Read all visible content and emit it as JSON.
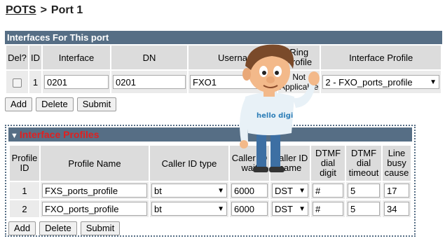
{
  "breadcrumb": {
    "root": "POTS",
    "sep": ">",
    "current": "Port 1"
  },
  "interfaces": {
    "header": "Interfaces For This port",
    "columns": [
      "Del?",
      "ID",
      "Interface",
      "DN",
      "Userna",
      "Ring Profile",
      "Interface Profile"
    ],
    "row": {
      "id": "1",
      "interface": "0201",
      "dn": "0201",
      "username": "FXO1",
      "ring_profile_top": "Not",
      "ring_profile_bottom": "Applicable",
      "interface_profile": "2 - FXO_ports_profile"
    },
    "buttons": {
      "add": "Add",
      "delete": "Delete",
      "submit": "Submit"
    }
  },
  "profiles": {
    "header": "Interface Profiles",
    "columns": {
      "profile_id": "Profile ID",
      "profile_name": "Profile Name",
      "caller_id_type": "Caller ID type",
      "caller_id_wait": "Caller ID wait",
      "caller_id_name": "Caller ID name",
      "dtmf_dial_digit": "DTMF dial digit",
      "dtmf_dial_timeout": "DTMF dial timeout",
      "line_busy_cause": "Line busy cause"
    },
    "rows": [
      {
        "id": "1",
        "name": "FXS_ports_profile",
        "caller_type": "bt",
        "wait": "6000",
        "dst": "DST",
        "digit": "#",
        "timeout": "5",
        "busy": "17"
      },
      {
        "id": "2",
        "name": "FXO_ports_profile",
        "caller_type": "bt",
        "wait": "6000",
        "dst": "DST",
        "digit": "#",
        "timeout": "5",
        "busy": "34"
      }
    ],
    "buttons": {
      "add": "Add",
      "delete": "Delete",
      "submit": "Submit"
    }
  },
  "mascot": {
    "shirt_text": "hello digi"
  }
}
